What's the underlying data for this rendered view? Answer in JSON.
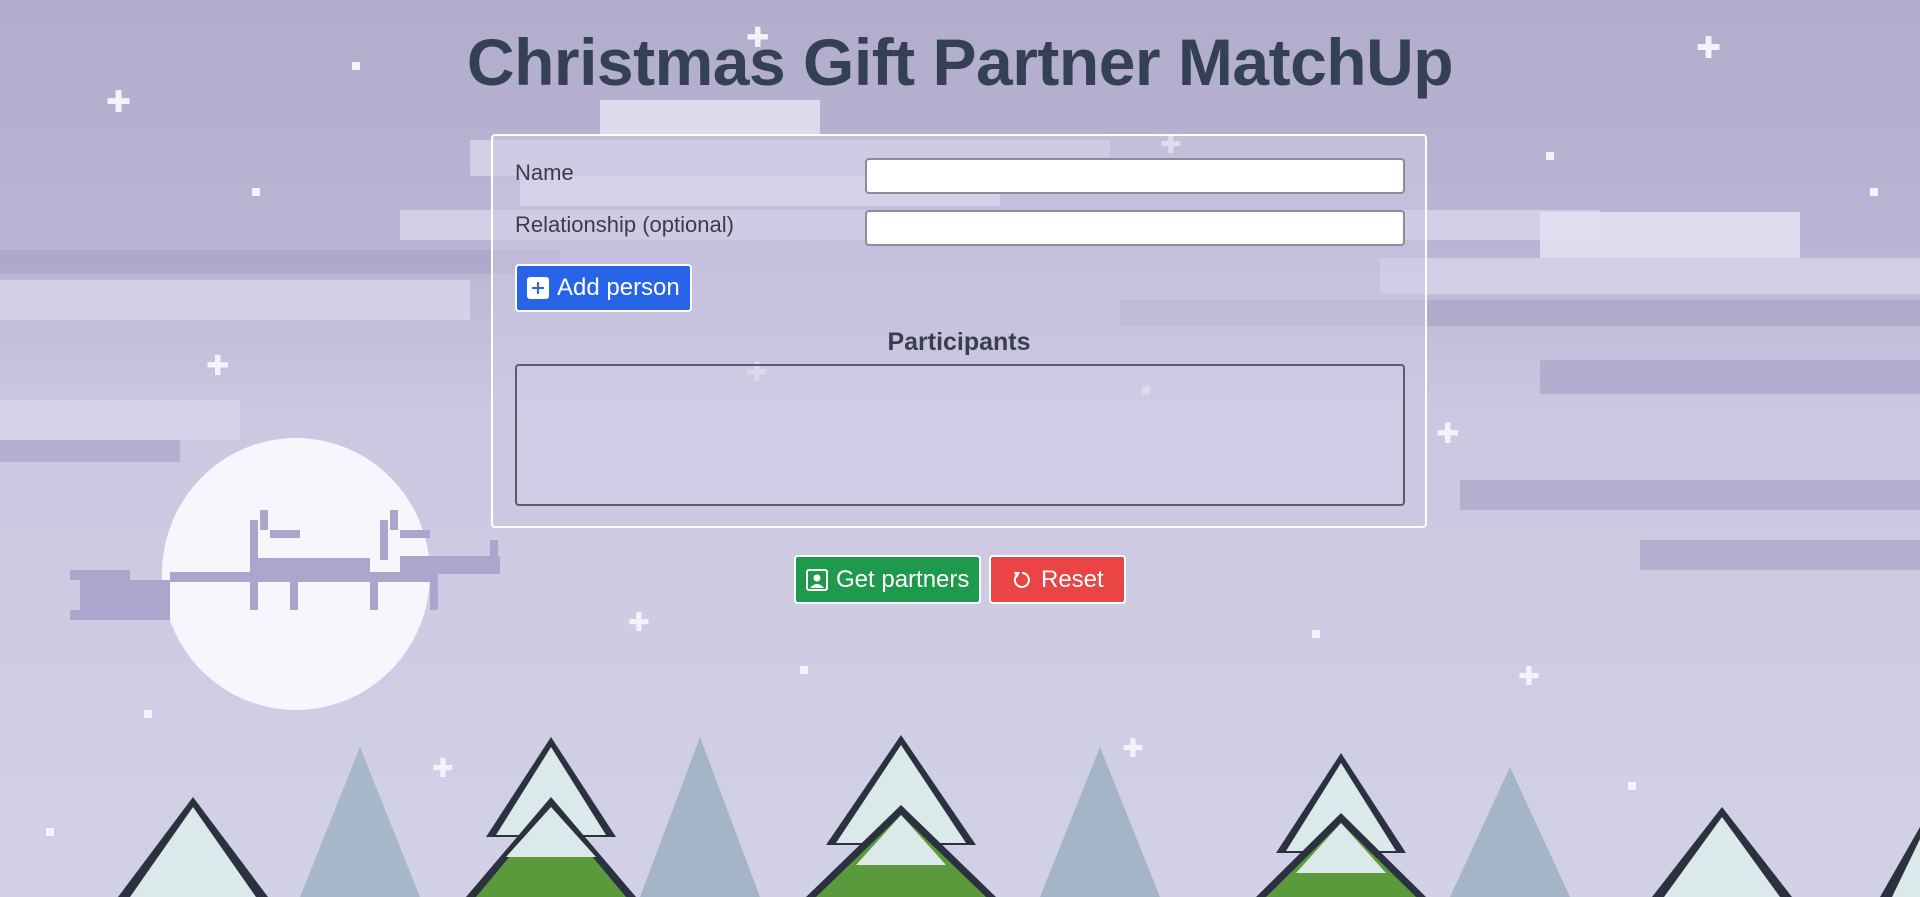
{
  "title": "Christmas Gift Partner MatchUp",
  "form": {
    "name_label": "Name",
    "name_value": "",
    "relationship_label": "Relationship (optional)",
    "relationship_value": "",
    "add_button": "Add person",
    "add_icon": "plus-square-icon"
  },
  "participants": {
    "heading": "Participants",
    "items": []
  },
  "actions": {
    "get_partners": "Get partners",
    "get_partners_icon": "person-square-icon",
    "reset": "Reset",
    "reset_icon": "reset-arrow-icon"
  },
  "colors": {
    "title": "#344155",
    "add_button": "#2764e8",
    "get_partners_button": "#1f9a4c",
    "reset_button": "#ea4444"
  }
}
